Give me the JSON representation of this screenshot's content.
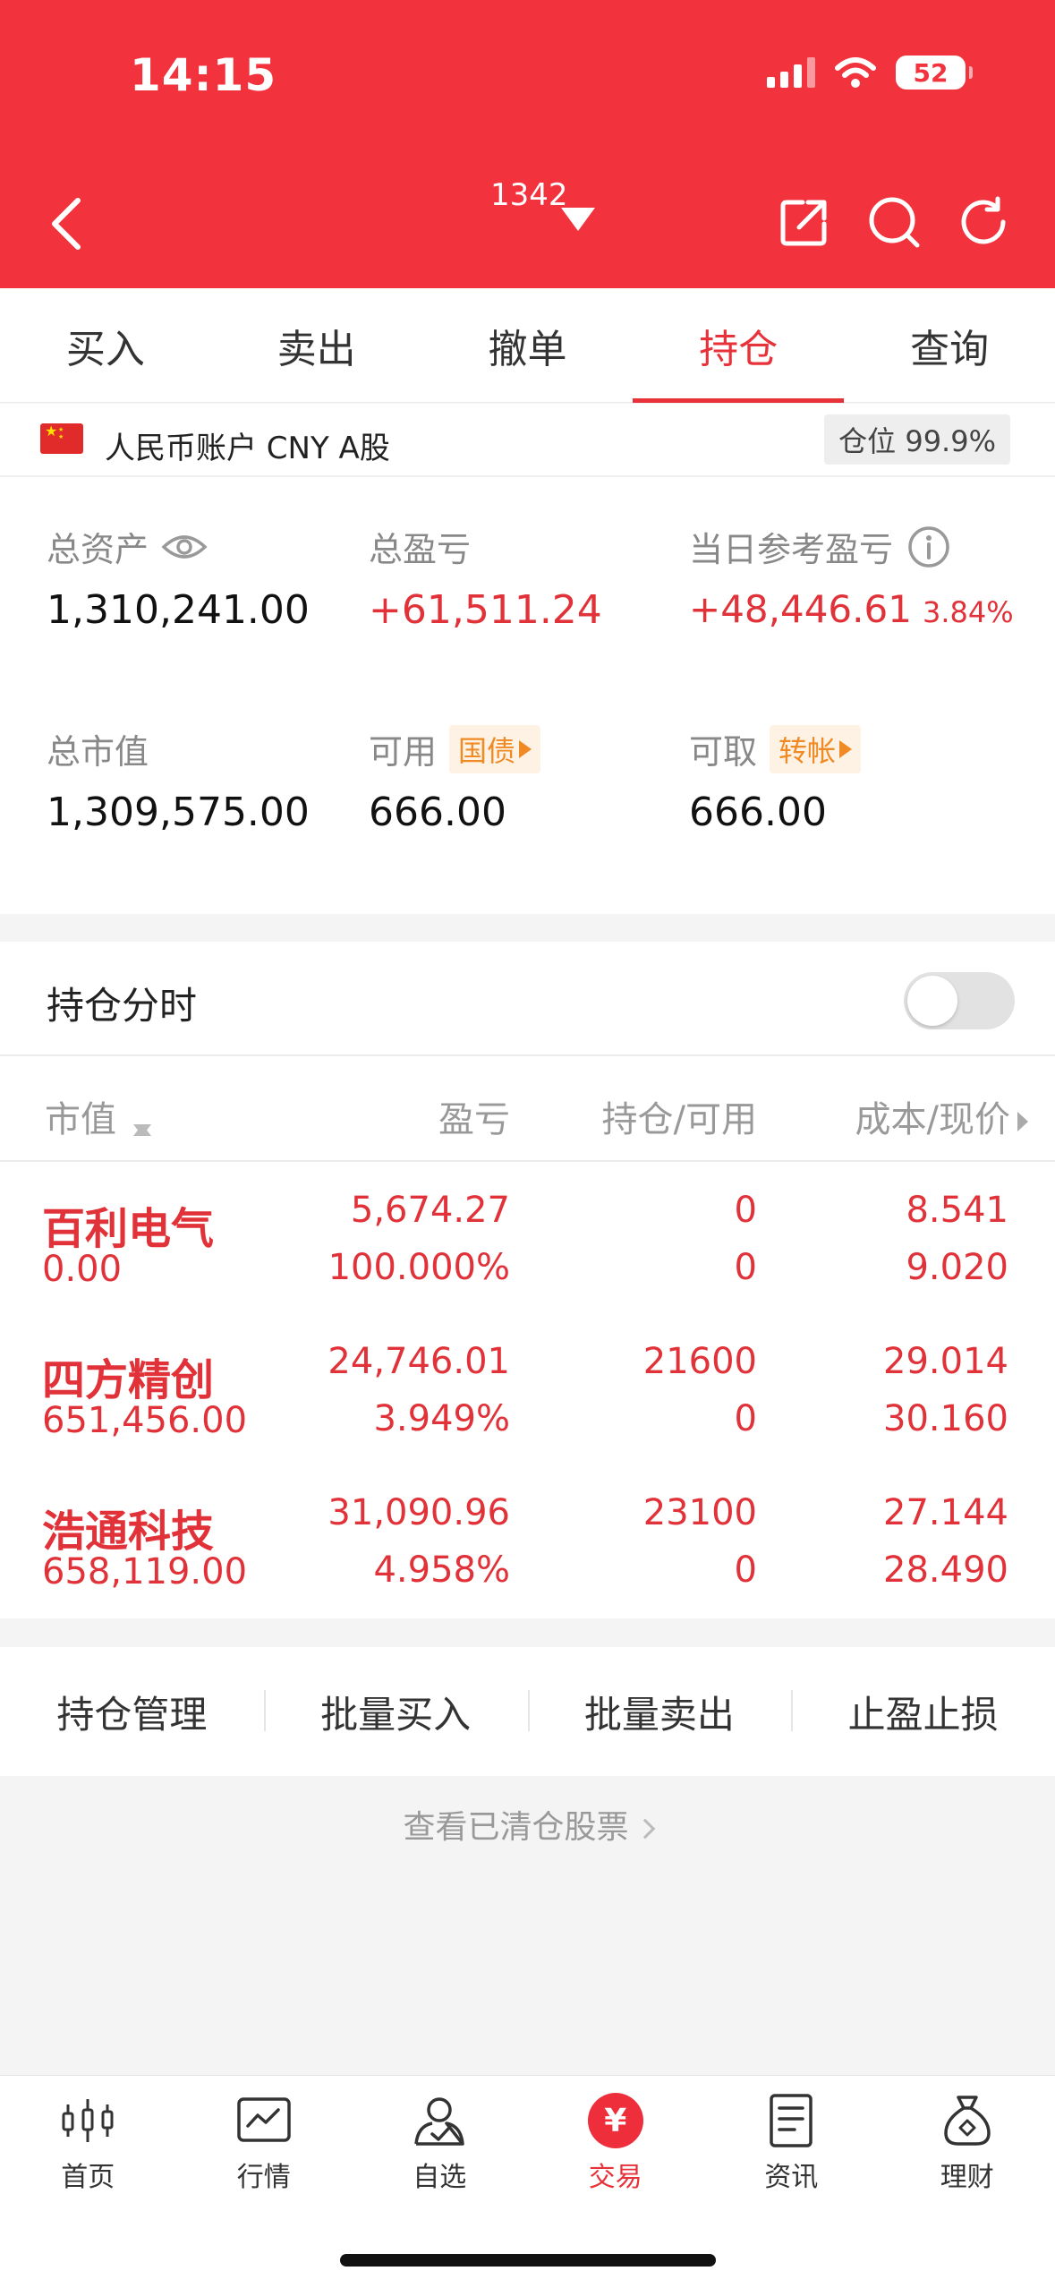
{
  "status_bar": {
    "time": "14:15",
    "battery": "52"
  },
  "header": {
    "account_number": "1342"
  },
  "tabs": [
    {
      "label": "买入"
    },
    {
      "label": "卖出"
    },
    {
      "label": "撤单"
    },
    {
      "label": "持仓",
      "active": true
    },
    {
      "label": "查询"
    }
  ],
  "account": {
    "name": "人民币账户 CNY A股",
    "position_ratio": "仓位 99.9%",
    "total_assets_label": "总资产",
    "total_assets": "1,310,241.00",
    "total_pl_label": "总盈亏",
    "total_pl": "+61,511.24",
    "daily_pl_label": "当日参考盈亏",
    "daily_pl": "+48,446.61",
    "daily_pl_pct": "3.84%",
    "market_value_label": "总市值",
    "market_value": "1,309,575.00",
    "available_label": "可用",
    "available_tag": "国债",
    "available": "666.00",
    "withdrawable_label": "可取",
    "withdrawable_tag": "转帐",
    "withdrawable": "666.00"
  },
  "holdings": {
    "toggle_label": "持仓分时",
    "toggle_on": false,
    "columns": {
      "market_value": "市值",
      "pl": "盈亏",
      "position": "持仓/可用",
      "cost": "成本/现价"
    },
    "rows": [
      {
        "name": "百利电气",
        "market_value": "0.00",
        "pl": "5,674.27",
        "pl_pct": "100.000%",
        "position": "0",
        "available": "0",
        "cost": "8.541",
        "price": "9.020"
      },
      {
        "name": "四方精创",
        "market_value": "651,456.00",
        "pl": "24,746.01",
        "pl_pct": "3.949%",
        "position": "21600",
        "available": "0",
        "cost": "29.014",
        "price": "30.160"
      },
      {
        "name": "浩通科技",
        "market_value": "658,119.00",
        "pl": "31,090.96",
        "pl_pct": "4.958%",
        "position": "23100",
        "available": "0",
        "cost": "27.144",
        "price": "28.490"
      }
    ]
  },
  "actions": [
    {
      "label": "持仓管理"
    },
    {
      "label": "批量买入"
    },
    {
      "label": "批量卖出"
    },
    {
      "label": "止盈止损"
    }
  ],
  "cleared_link": "查看已清仓股票",
  "bottom_nav": [
    {
      "label": "首页",
      "icon": "candlestick-icon"
    },
    {
      "label": "行情",
      "icon": "chart-icon"
    },
    {
      "label": "自选",
      "icon": "user-check-icon"
    },
    {
      "label": "交易",
      "icon": "yuan-icon",
      "active": true,
      "glyph": "¥"
    },
    {
      "label": "资讯",
      "icon": "document-icon"
    },
    {
      "label": "理财",
      "icon": "moneybag-icon"
    }
  ],
  "colors": {
    "brand_red": "#f2323c",
    "profit_red": "#e03238",
    "tag_orange": "#f08a24"
  }
}
